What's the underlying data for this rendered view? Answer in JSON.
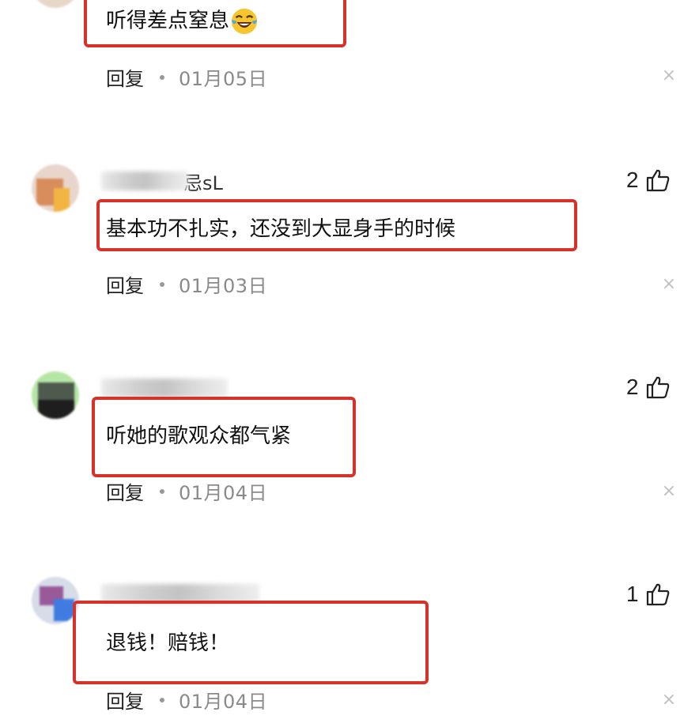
{
  "comments": [
    {
      "username": "",
      "text": "听得差点窒息",
      "emoji": "laughing-crying-emoji",
      "reply_label": "回复",
      "date": "01月05日",
      "likes": ""
    },
    {
      "username": "...怒sL",
      "username_visible": "忌sL",
      "text": "基本功不扎实，还没到大显身手的时候",
      "reply_label": "回复",
      "date": "01月03日",
      "likes": "2"
    },
    {
      "username": "",
      "text": "听她的歌观众都气紧",
      "reply_label": "回复",
      "date": "01月04日",
      "likes": "2"
    },
    {
      "username": "",
      "text": "退钱！赔钱！",
      "reply_label": "回复",
      "date": "01月04日",
      "likes": "1"
    }
  ],
  "icons": {
    "like": "thumbs-up-icon",
    "close": "close-icon"
  },
  "colors": {
    "highlight": "#d7312a",
    "date": "#8a8a8a",
    "close": "#c0c0c0"
  }
}
